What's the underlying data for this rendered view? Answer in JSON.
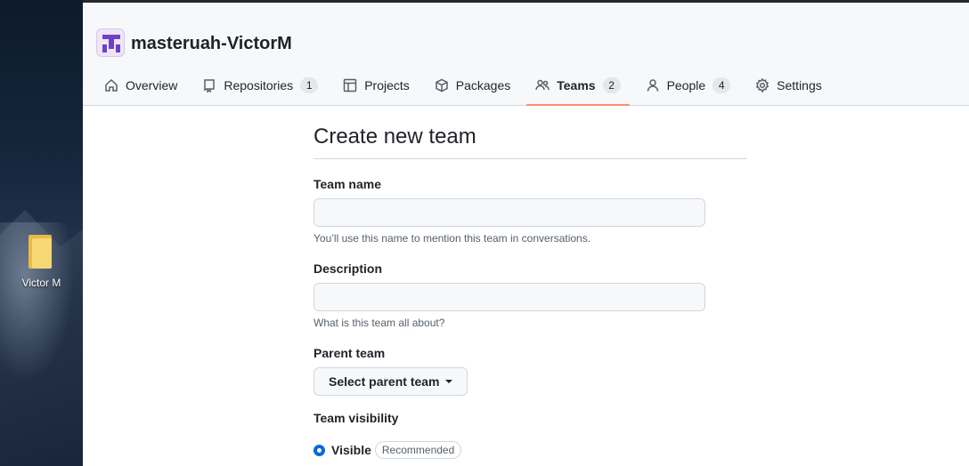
{
  "desktop": {
    "folder_label": "Victor M"
  },
  "org": {
    "name": "masteruah-VictorM"
  },
  "nav": {
    "items": [
      {
        "label": "Overview",
        "icon": "home-icon"
      },
      {
        "label": "Repositories",
        "icon": "repo-icon",
        "count": "1"
      },
      {
        "label": "Projects",
        "icon": "table-icon"
      },
      {
        "label": "Packages",
        "icon": "package-icon"
      },
      {
        "label": "Teams",
        "icon": "people-icon",
        "count": "2",
        "active": true
      },
      {
        "label": "People",
        "icon": "person-icon",
        "count": "4"
      },
      {
        "label": "Settings",
        "icon": "gear-icon"
      }
    ]
  },
  "form": {
    "title": "Create new team",
    "team_name": {
      "label": "Team name",
      "value": "",
      "note": "You’ll use this name to mention this team in conversations."
    },
    "description": {
      "label": "Description",
      "value": "",
      "note": "What is this team all about?"
    },
    "parent_team": {
      "label": "Parent team",
      "button": "Select parent team"
    },
    "visibility": {
      "label": "Team visibility",
      "option_label": "Visible",
      "option_badge": "Recommended",
      "selected": true
    }
  },
  "colors": {
    "active_tab_underline": "#fd8c73",
    "radio_accent": "#0969da",
    "org_avatar": "#6f42c1"
  }
}
